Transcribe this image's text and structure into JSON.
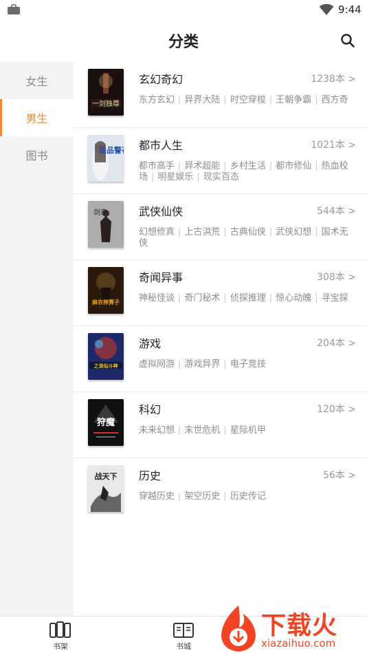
{
  "status_bar": {
    "time": "9:44",
    "left_icon": "briefcase-icon",
    "wifi_icon": "wifi-icon"
  },
  "header": {
    "title": "分类",
    "search_icon": "search-icon"
  },
  "sidebar": {
    "items": [
      {
        "label": "女生",
        "active": false
      },
      {
        "label": "男生",
        "active": true
      },
      {
        "label": "图书",
        "active": false
      }
    ]
  },
  "categories": [
    {
      "name": "玄幻奇幻",
      "count": "1238本 >",
      "tags_line1": [
        "东方玄幻",
        "异界大陆",
        "时空穿梭",
        "王朝争霸",
        "西方奇"
      ],
      "tags_line2": []
    },
    {
      "name": "都市人生",
      "count": "1021本 >",
      "tags_line1": [
        "都市高手",
        "异术超能",
        "乡村生活",
        "都市修仙",
        "热血校"
      ],
      "tags_line2": [
        "场",
        "明星娱乐",
        "现实百态"
      ]
    },
    {
      "name": "武侠仙侠",
      "count": "544本 >",
      "tags_line1": [
        "幻想修真",
        "上古洪荒",
        "古典仙侠",
        "武侠幻想",
        "国术无"
      ],
      "tags_line2": [
        "侠"
      ]
    },
    {
      "name": "奇闻异事",
      "count": "308本 >",
      "tags_line1": [
        "神秘怪谈",
        "奇门秘术",
        "侦探推理",
        "惊心动魄",
        "寻宝探"
      ],
      "tags_line2": []
    },
    {
      "name": "游戏",
      "count": "204本 >",
      "tags_line1": [
        "虚拟网游",
        "游戏异界",
        "电子竞技"
      ],
      "tags_line2": []
    },
    {
      "name": "科幻",
      "count": "120本 >",
      "tags_line1": [
        "未来幻想",
        "末世危机",
        "星际机甲"
      ],
      "tags_line2": []
    },
    {
      "name": "历史",
      "count": "56本 >",
      "tags_line1": [
        "穿越历史",
        "架空历史",
        "历史传记"
      ],
      "tags_line2": []
    }
  ],
  "covers": [
    {
      "title": "一剑独尊",
      "bg": "#1a1010",
      "accent": "#c8a060"
    },
    {
      "title": "极品警花",
      "bg": "#dfe6ef",
      "accent": "#2a4fa8"
    },
    {
      "title": "剑来",
      "bg": "#9a9a9a",
      "accent": "#2a2020"
    },
    {
      "title": "麻衣神算子",
      "bg": "#2a1a0c",
      "accent": "#e8a020"
    },
    {
      "title": "之诛仙斗神",
      "bg": "#1e2a6a",
      "accent": "#f0c020"
    },
    {
      "title": "狩魔",
      "bg": "#101010",
      "accent": "#d83030"
    },
    {
      "title": "战天下",
      "bg": "#e8e8e8",
      "accent": "#222222"
    }
  ],
  "bottom_nav": [
    {
      "label": "书架",
      "icon": "bookshelf-icon"
    },
    {
      "label": "书城",
      "icon": "book-open-icon"
    }
  ],
  "watermark": {
    "text": "下载火",
    "url": "xiazaihuo.com"
  },
  "colors": {
    "accent": "#f08a3a",
    "watermark": "#f24422"
  }
}
